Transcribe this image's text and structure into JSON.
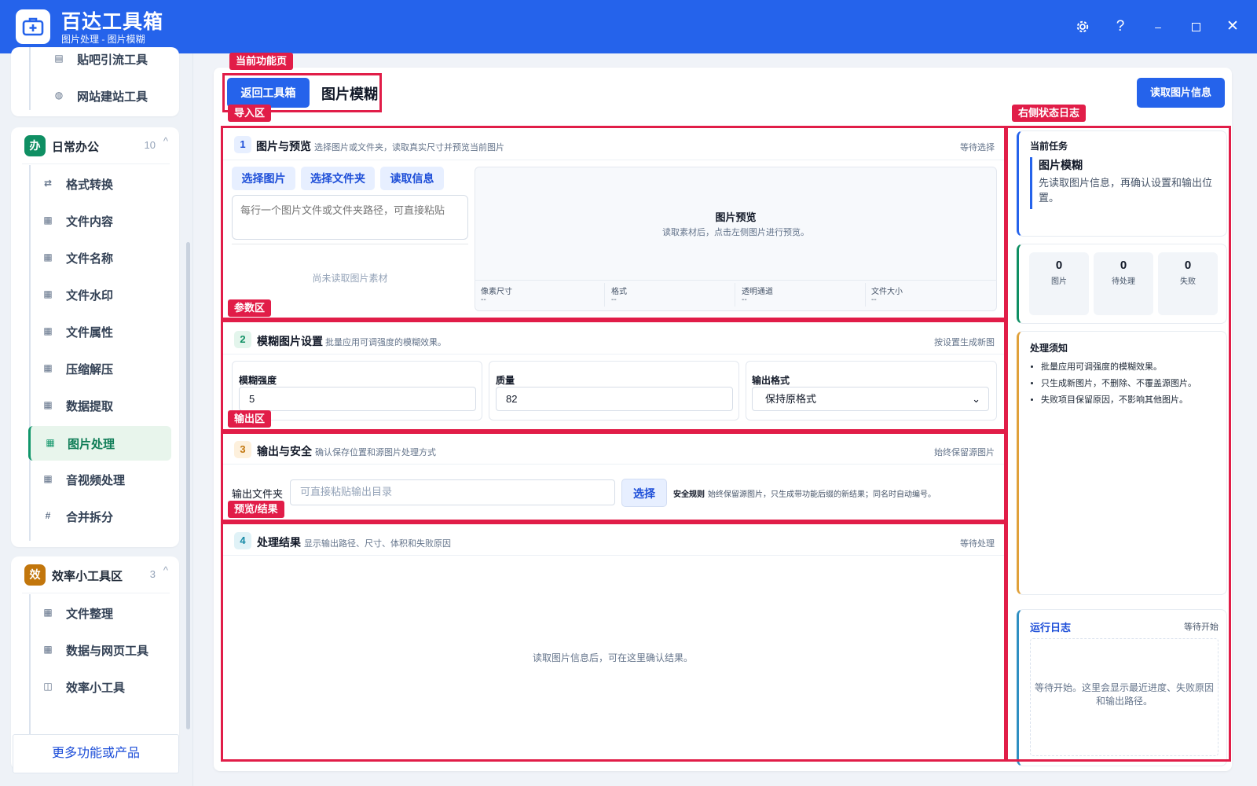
{
  "app": {
    "title": "百达工具箱",
    "subtitle": "图片处理 - 图片模糊"
  },
  "sidebar": {
    "top_items": [
      {
        "label": "贴吧引流工具",
        "icon": "document-icon"
      },
      {
        "label": "网站建站工具",
        "icon": "globe-icon"
      }
    ],
    "groups": [
      {
        "badge": "办",
        "badge_color": "#0f8f63",
        "name": "日常办公",
        "count": "10",
        "items": [
          {
            "label": "格式转换",
            "icon": "swap-icon"
          },
          {
            "label": "文件内容",
            "icon": "grid-icon"
          },
          {
            "label": "文件名称",
            "icon": "grid-icon"
          },
          {
            "label": "文件水印",
            "icon": "grid-icon"
          },
          {
            "label": "文件属性",
            "icon": "grid-icon"
          },
          {
            "label": "压缩解压",
            "icon": "grid-icon"
          },
          {
            "label": "数据提取",
            "icon": "grid-icon"
          },
          {
            "label": "图片处理",
            "icon": "grid-icon",
            "active": true
          },
          {
            "label": "音视频处理",
            "icon": "grid-icon"
          },
          {
            "label": "合并拆分",
            "icon": "hash-icon"
          }
        ]
      },
      {
        "badge": "效",
        "badge_color": "#c2760c",
        "name": "效率小工具区",
        "count": "3",
        "items": [
          {
            "label": "文件整理",
            "icon": "grid-icon"
          },
          {
            "label": "数据与网页工具",
            "icon": "grid-icon"
          },
          {
            "label": "效率小工具",
            "icon": "box-icon"
          }
        ]
      }
    ],
    "more_label": "更多功能或产品"
  },
  "annotations": {
    "current_page": "当前功能页",
    "import": "导入区",
    "params": "参数区",
    "output": "输出区",
    "preview": "预览/结果",
    "right_log": "右侧状态日志"
  },
  "header": {
    "back_label": "返回工具箱",
    "page_title": "图片模糊",
    "read_info_label": "读取图片信息"
  },
  "section1": {
    "num": "1",
    "title": "图片与预览",
    "desc": "选择图片或文件夹，读取真实尺寸并预览当前图片",
    "status": "等待选择",
    "buttons": {
      "select_image": "选择图片",
      "select_folder": "选择文件夹",
      "read_info": "读取信息"
    },
    "paths_placeholder": "每行一个图片文件或文件夹路径，可直接粘贴",
    "empty_text": "尚未读取图片素材",
    "preview_title": "图片预览",
    "preview_hint": "读取素材后，点击左侧图片进行预览。",
    "meta": [
      {
        "label": "像素尺寸",
        "value": "--"
      },
      {
        "label": "格式",
        "value": "--"
      },
      {
        "label": "透明通道",
        "value": "--"
      },
      {
        "label": "文件大小",
        "value": "--"
      }
    ]
  },
  "section2": {
    "num": "2",
    "title": "模糊图片设置",
    "desc": "批量应用可调强度的模糊效果。",
    "status": "按设置生成新图",
    "blur": {
      "label": "模糊强度",
      "value": "5"
    },
    "quality": {
      "label": "质量",
      "value": "82"
    },
    "format": {
      "label": "输出格式",
      "value": "保持原格式"
    }
  },
  "section3": {
    "num": "3",
    "title": "输出与安全",
    "desc": "确认保存位置和源图片处理方式",
    "status": "始终保留源图片",
    "folder_label": "输出文件夹",
    "folder_placeholder": "可直接粘贴输出目录",
    "choose_label": "选择",
    "safety_title": "安全规则",
    "safety_text": "始终保留源图片，只生成带功能后缀的新结果；同名时自动编号。"
  },
  "section4": {
    "num": "4",
    "title": "处理结果",
    "desc": "显示输出路径、尺寸、体积和失败原因",
    "status": "等待处理",
    "empty_text": "读取图片信息后，可在这里确认结果。"
  },
  "right_panel": {
    "task_label": "当前任务",
    "task_title": "图片模糊",
    "task_desc": "先读取图片信息，再确认设置和输出位置。",
    "stats": [
      {
        "value": "0",
        "label": "图片"
      },
      {
        "value": "0",
        "label": "待处理"
      },
      {
        "value": "0",
        "label": "失败"
      }
    ],
    "notes_title": "处理须知",
    "notes": [
      "批量应用可调强度的模糊效果。",
      "只生成新图片，不删除、不覆盖源图片。",
      "失败项目保留原因，不影响其他图片。"
    ],
    "log_title": "运行日志",
    "log_status": "等待开始",
    "log_text": "等待开始。这里会显示最近进度、失败原因和输出路径。"
  }
}
